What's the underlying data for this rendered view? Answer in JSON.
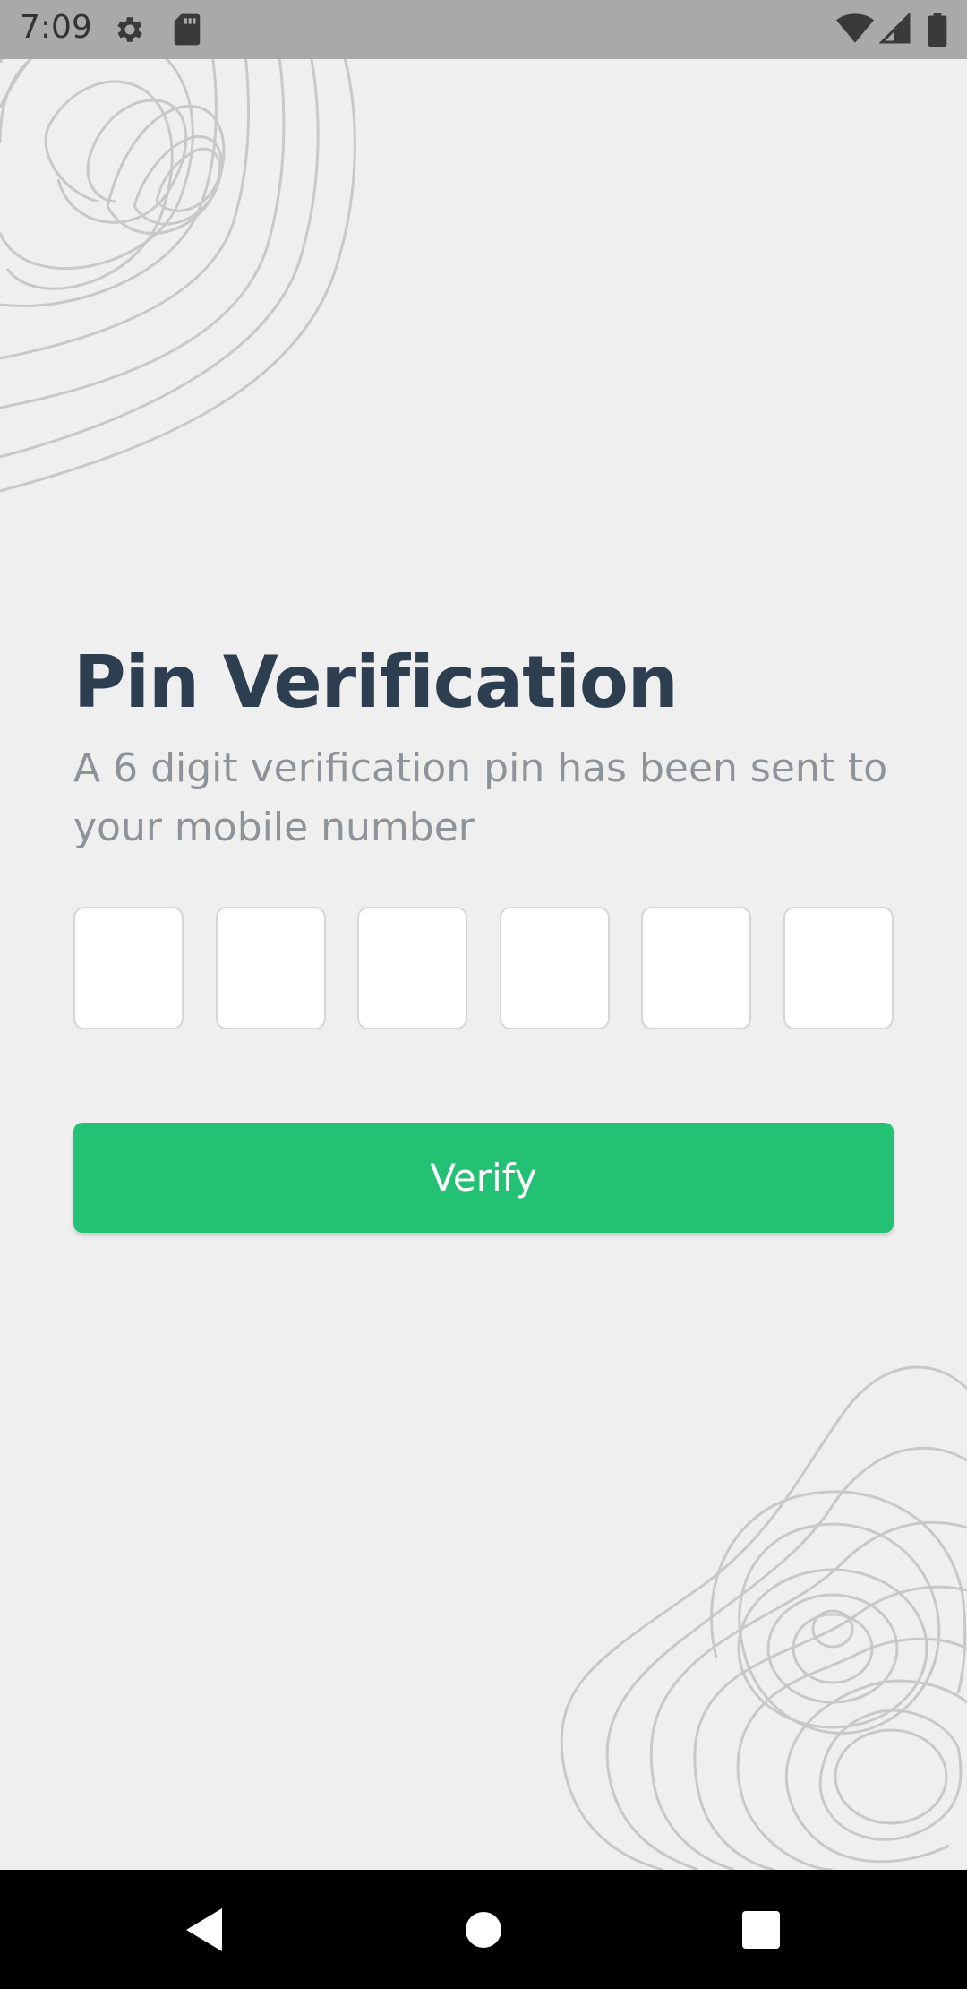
{
  "status_bar": {
    "time": "7:09",
    "icons": [
      "gear-icon",
      "sd-card-icon",
      "wifi-icon",
      "signal-icon",
      "battery-icon"
    ]
  },
  "main": {
    "title": "Pin Verification",
    "subtitle": "A 6 digit verification pin has been sent to your mobile number",
    "pin_digits": [
      "",
      "",
      "",
      "",
      "",
      ""
    ],
    "verify_label": "Verify"
  },
  "colors": {
    "background": "#efefef",
    "title": "#2c3e50",
    "subtitle": "#8e9399",
    "accent": "#22c174",
    "status_bar": "#a9a9a9",
    "nav_bar": "#000000"
  },
  "nav_bar": {
    "icons": [
      "back-icon",
      "home-icon",
      "recents-icon"
    ]
  }
}
